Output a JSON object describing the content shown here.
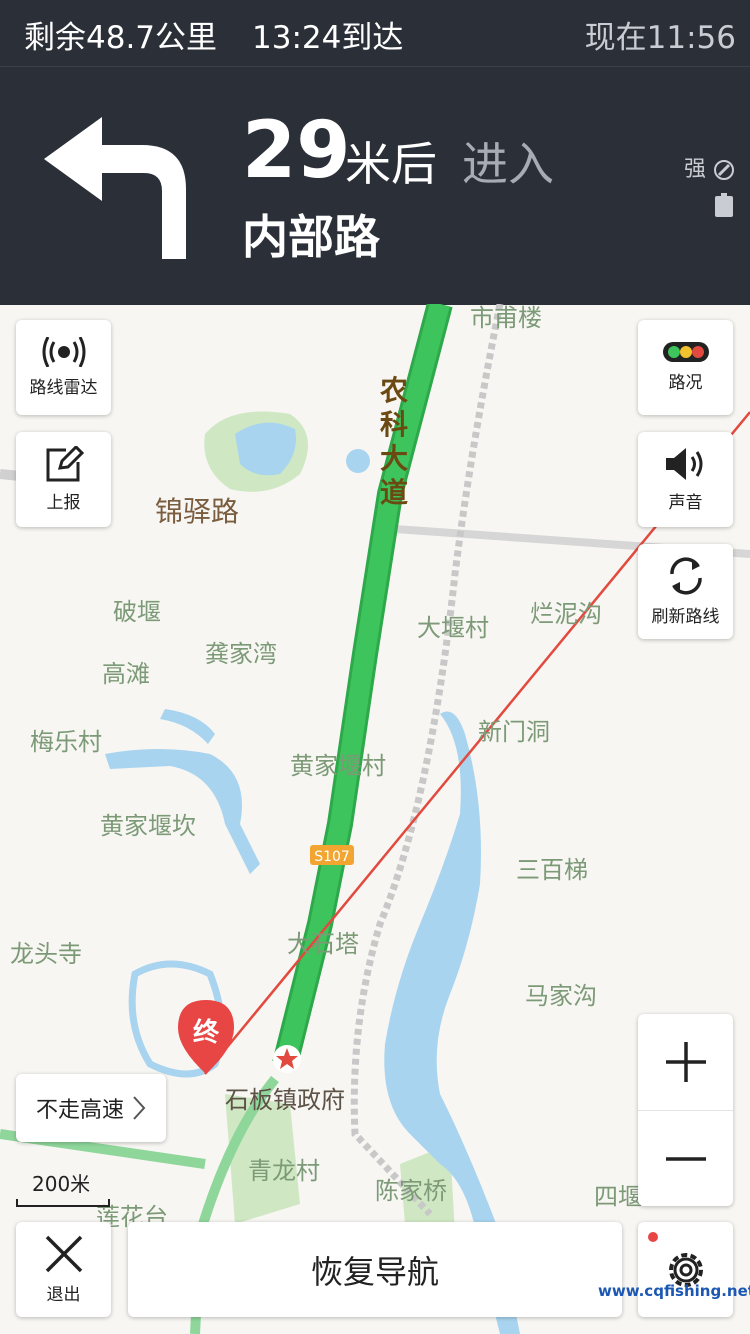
{
  "status": {
    "remaining": "剩余48.7公里",
    "arrival": "13:24到达",
    "now": "现在11:56"
  },
  "guidance": {
    "distance": "29",
    "unit": "米后",
    "action": "进入",
    "road": "内部路",
    "signal": "强"
  },
  "left_buttons": [
    {
      "label": "路线雷达",
      "icon": "radar-icon"
    },
    {
      "label": "上报",
      "icon": "edit-icon"
    }
  ],
  "right_buttons": [
    {
      "label": "路况",
      "icon": "traffic-light-icon"
    },
    {
      "label": "声音",
      "icon": "speaker-icon"
    },
    {
      "label": "刷新路线",
      "icon": "refresh-icon"
    }
  ],
  "places": {
    "road_vertical": "农科大道",
    "jinyi": "锦驿路",
    "poyan": "破堰",
    "gaotan": "高滩",
    "gongjiawan": "龚家湾",
    "meile": "梅乐村",
    "huangjiayankan": "黄家堰坎",
    "huangjiayancun": "黄家堰村",
    "dayan": "大堰村",
    "lannigou": "烂泥沟",
    "xinmen": "新门洞",
    "sanbaiti": "三百梯",
    "longtousi": "龙头寺",
    "dashita": "大石塔",
    "majiagou": "马家沟",
    "shiban": "石板镇政府",
    "qinglong": "青龙村",
    "chenjiaqiao": "陈家桥",
    "lianhuatai": "莲花台",
    "siyan": "四堰",
    "shijialou": "市甫楼",
    "s107": "S107",
    "end_marker": "终"
  },
  "avoid_highway": "不走高速",
  "scale": "200米",
  "exit_label": "退出",
  "resume": "恢复导航",
  "watermark": "www.cqfishing.net",
  "colors": {
    "route": "#3ec45c",
    "water": "#a8d4f0",
    "greenery": "#cfe8c3",
    "end_pin": "#e84545",
    "nav_bg": "#2b2f38"
  }
}
